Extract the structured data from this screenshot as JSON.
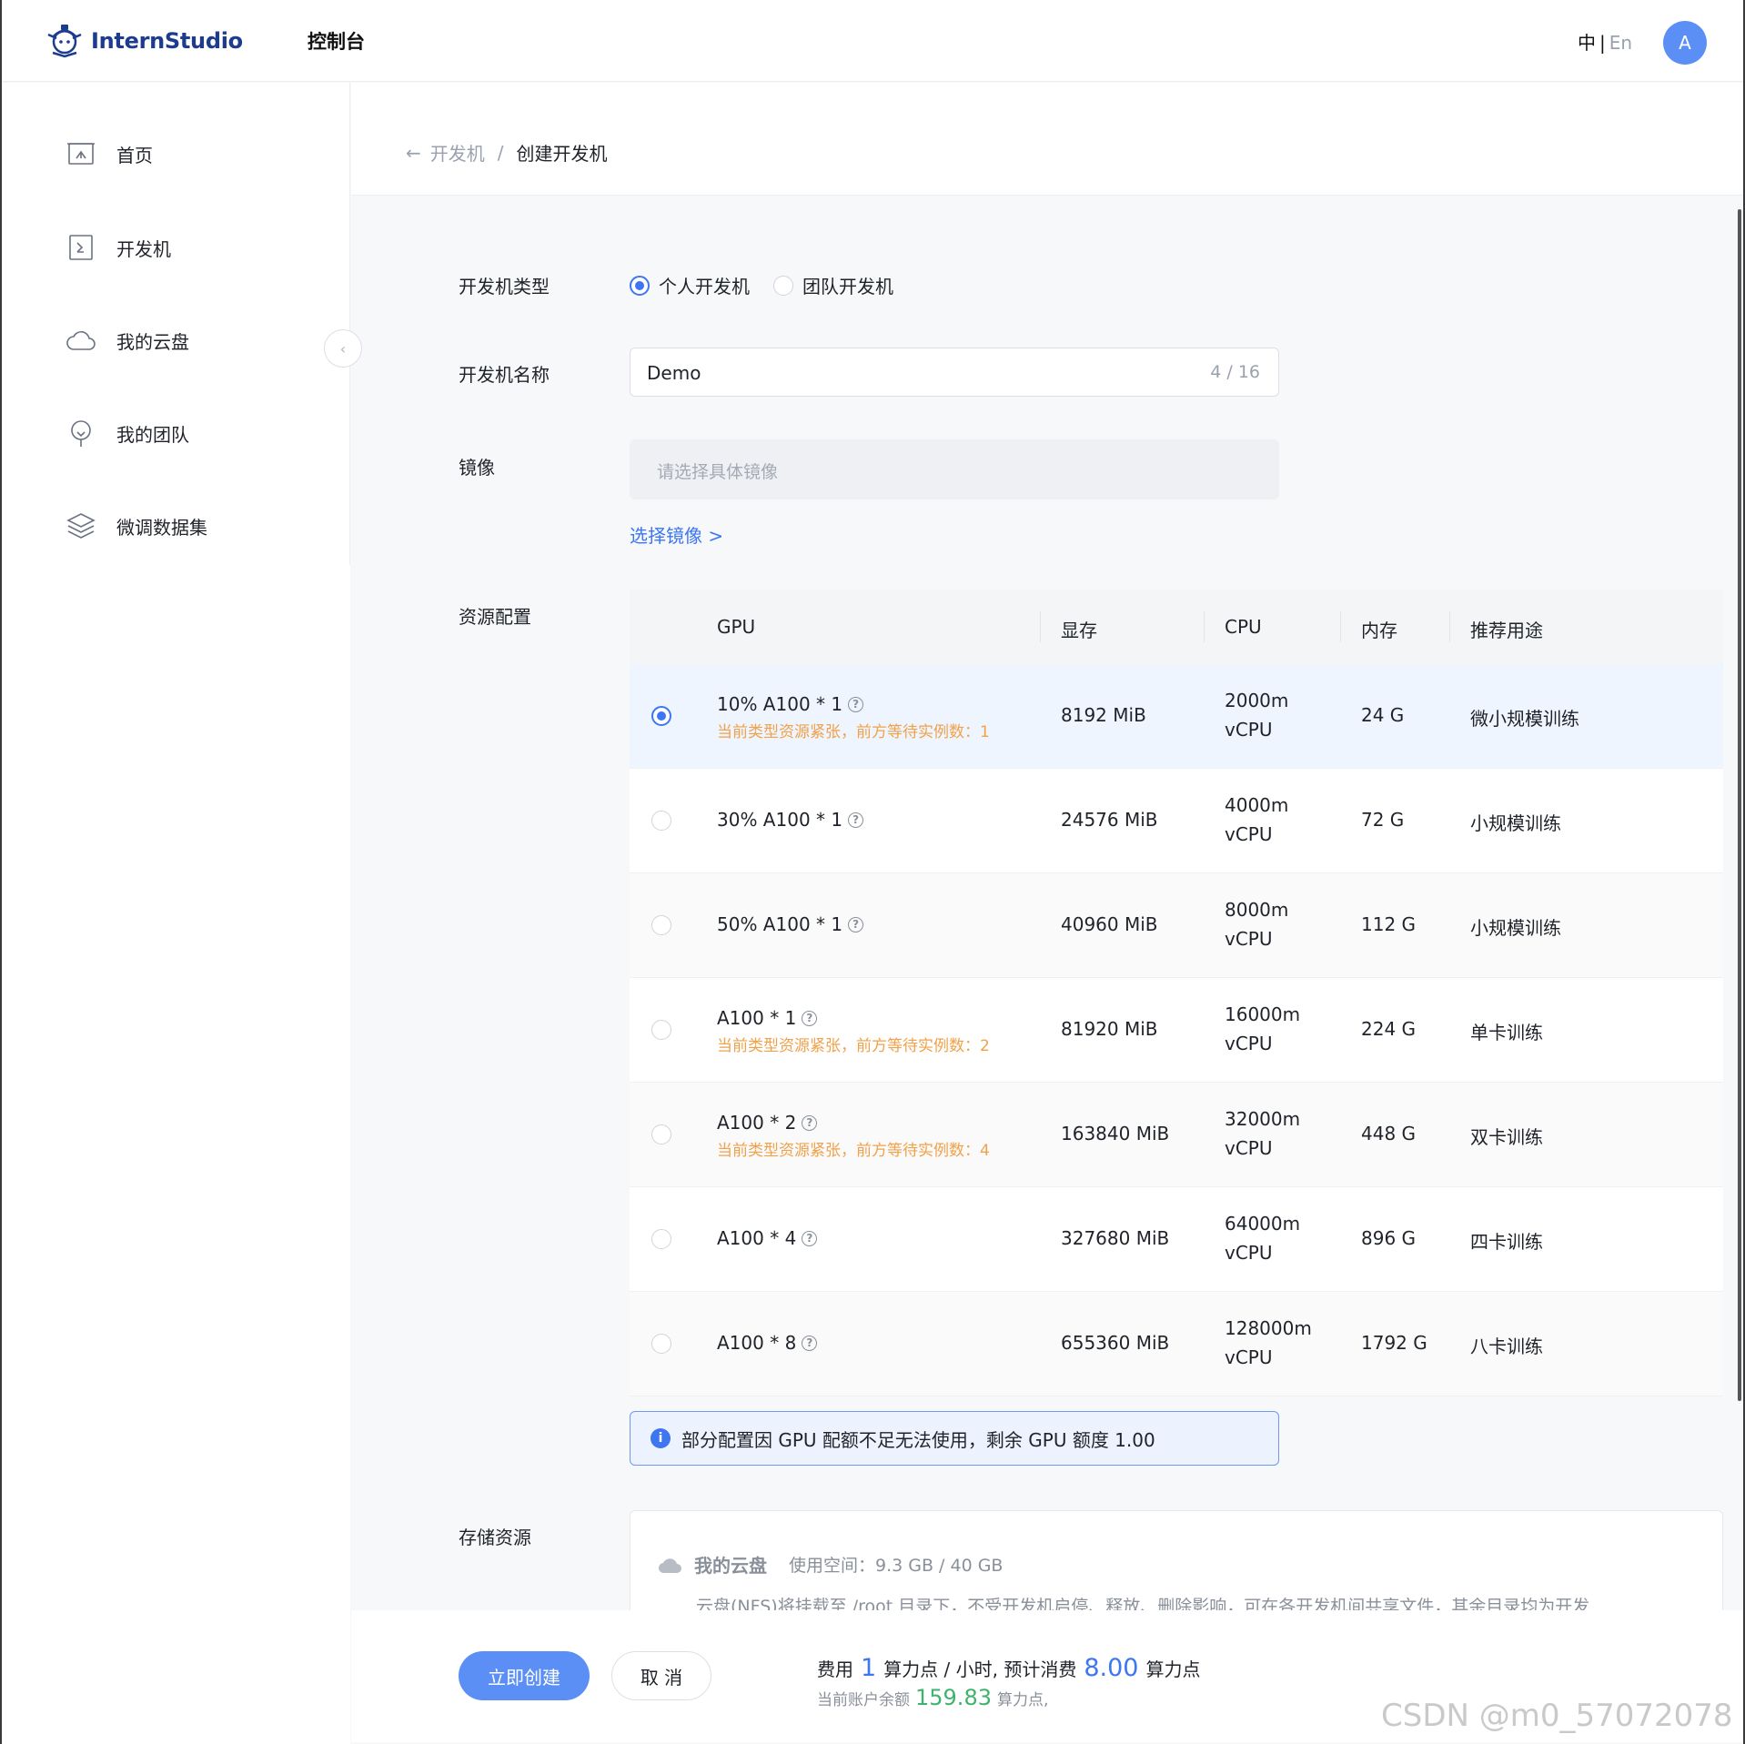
{
  "header": {
    "logo_text": "InternStudio",
    "console_title": "控制台",
    "lang_zh": "中",
    "lang_sep": "|",
    "lang_en": "En",
    "avatar_initial": "A"
  },
  "sidebar": {
    "items": [
      {
        "label": "首页",
        "icon": "home-icon"
      },
      {
        "label": "开发机",
        "icon": "terminal-icon"
      },
      {
        "label": "我的云盘",
        "icon": "cloud-icon"
      },
      {
        "label": "我的团队",
        "icon": "team-icon"
      },
      {
        "label": "微调数据集",
        "icon": "layers-icon"
      }
    ],
    "collapse_icon": "‹"
  },
  "breadcrumb": {
    "back_icon": "←",
    "parent": "开发机",
    "separator": "/",
    "current": "创建开发机"
  },
  "form": {
    "type_label": "开发机类型",
    "type_options": [
      "个人开发机",
      "团队开发机"
    ],
    "type_selected": "个人开发机",
    "name_label": "开发机名称",
    "name_value": "Demo",
    "name_count": "4 / 16",
    "image_label": "镜像",
    "image_placeholder": "请选择具体镜像",
    "select_image_link": "选择镜像 >",
    "resource_label": "资源配置",
    "storage_label": "存储资源"
  },
  "resource_table": {
    "headers": [
      "GPU",
      "显存",
      "CPU",
      "内存",
      "推荐用途"
    ],
    "rows": [
      {
        "gpu": "10% A100 * 1",
        "warning": "当前类型资源紧张，前方等待实例数：1",
        "mem": "8192 MiB",
        "cpu1": "2000m",
        "cpu2": "vCPU",
        "ram": "24 G",
        "use": "微小规模训练",
        "selected": true
      },
      {
        "gpu": "30% A100 * 1",
        "warning": "",
        "mem": "24576 MiB",
        "cpu1": "4000m",
        "cpu2": "vCPU",
        "ram": "72 G",
        "use": "小规模训练",
        "selected": false
      },
      {
        "gpu": "50% A100 * 1",
        "warning": "",
        "mem": "40960 MiB",
        "cpu1": "8000m",
        "cpu2": "vCPU",
        "ram": "112 G",
        "use": "小规模训练",
        "selected": false
      },
      {
        "gpu": "A100 * 1",
        "warning": "当前类型资源紧张，前方等待实例数：2",
        "mem": "81920 MiB",
        "cpu1": "16000m",
        "cpu2": "vCPU",
        "ram": "224 G",
        "use": "单卡训练",
        "selected": false
      },
      {
        "gpu": "A100 * 2",
        "warning": "当前类型资源紧张，前方等待实例数：4",
        "mem": "163840 MiB",
        "cpu1": "32000m",
        "cpu2": "vCPU",
        "ram": "448 G",
        "use": "双卡训练",
        "selected": false
      },
      {
        "gpu": "A100 * 4",
        "warning": "",
        "mem": "327680 MiB",
        "cpu1": "64000m",
        "cpu2": "vCPU",
        "ram": "896 G",
        "use": "四卡训练",
        "selected": false
      },
      {
        "gpu": "A100 * 8",
        "warning": "",
        "mem": "655360 MiB",
        "cpu1": "128000m",
        "cpu2": "vCPU",
        "ram": "1792 G",
        "use": "八卡训练",
        "selected": false
      }
    ]
  },
  "notice": {
    "icon": "i",
    "text": "部分配置因 GPU 配额不足无法使用，剩余 GPU 额度 1.00"
  },
  "storage": {
    "title": "我的云盘",
    "usage": "使用空间：9.3 GB / 40 GB",
    "description": "云盘(NFS)将挂载至 /root 目录下，不受开发机启停、释放、删除影响，可在各开发机间共享文件，其余目录均为开发"
  },
  "footer": {
    "create_button": "立即创建",
    "cancel_button": "取 消",
    "fee_label": "费用",
    "fee_rate": "1",
    "fee_unit": "算力点 / 小时, 预计消费",
    "fee_total": "8.00",
    "fee_total_unit": "算力点",
    "balance_label": "当前账户余额",
    "balance_value": "159.83",
    "balance_unit": "算力点,"
  },
  "watermark": "CSDN @m0_57072078",
  "colors": {
    "accent": "#3d76f0",
    "warning": "#f0a14a",
    "success": "#3fb26d",
    "selected_row": "#eef5fe"
  }
}
